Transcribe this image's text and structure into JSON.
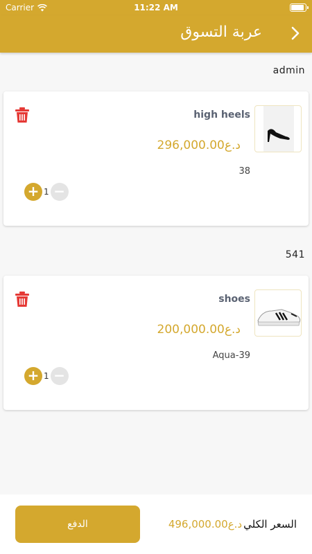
{
  "status_bar": {
    "carrier": "Carrier",
    "time": "11:22 AM"
  },
  "header": {
    "title": "عربة التسوق",
    "back_icon": "chevron-right-icon"
  },
  "groups": [
    {
      "label": "admin",
      "item": {
        "name": "high heels",
        "price": "296,000.00د.ع",
        "variant": "38",
        "quantity": "1",
        "image": "high-heel-shoe"
      }
    },
    {
      "label": "541",
      "item": {
        "name": "shoes",
        "price": "200,000.00د.ع",
        "variant": "Aqua-39",
        "quantity": "1",
        "image": "sneaker"
      }
    }
  ],
  "footer": {
    "pay_label": "الدفع",
    "total_label": "السعر الكلي",
    "total_amount": "496,000.00د.ع"
  },
  "colors": {
    "accent": "#d4a82e",
    "delete": "#e53935",
    "name_text": "#5a6272"
  }
}
